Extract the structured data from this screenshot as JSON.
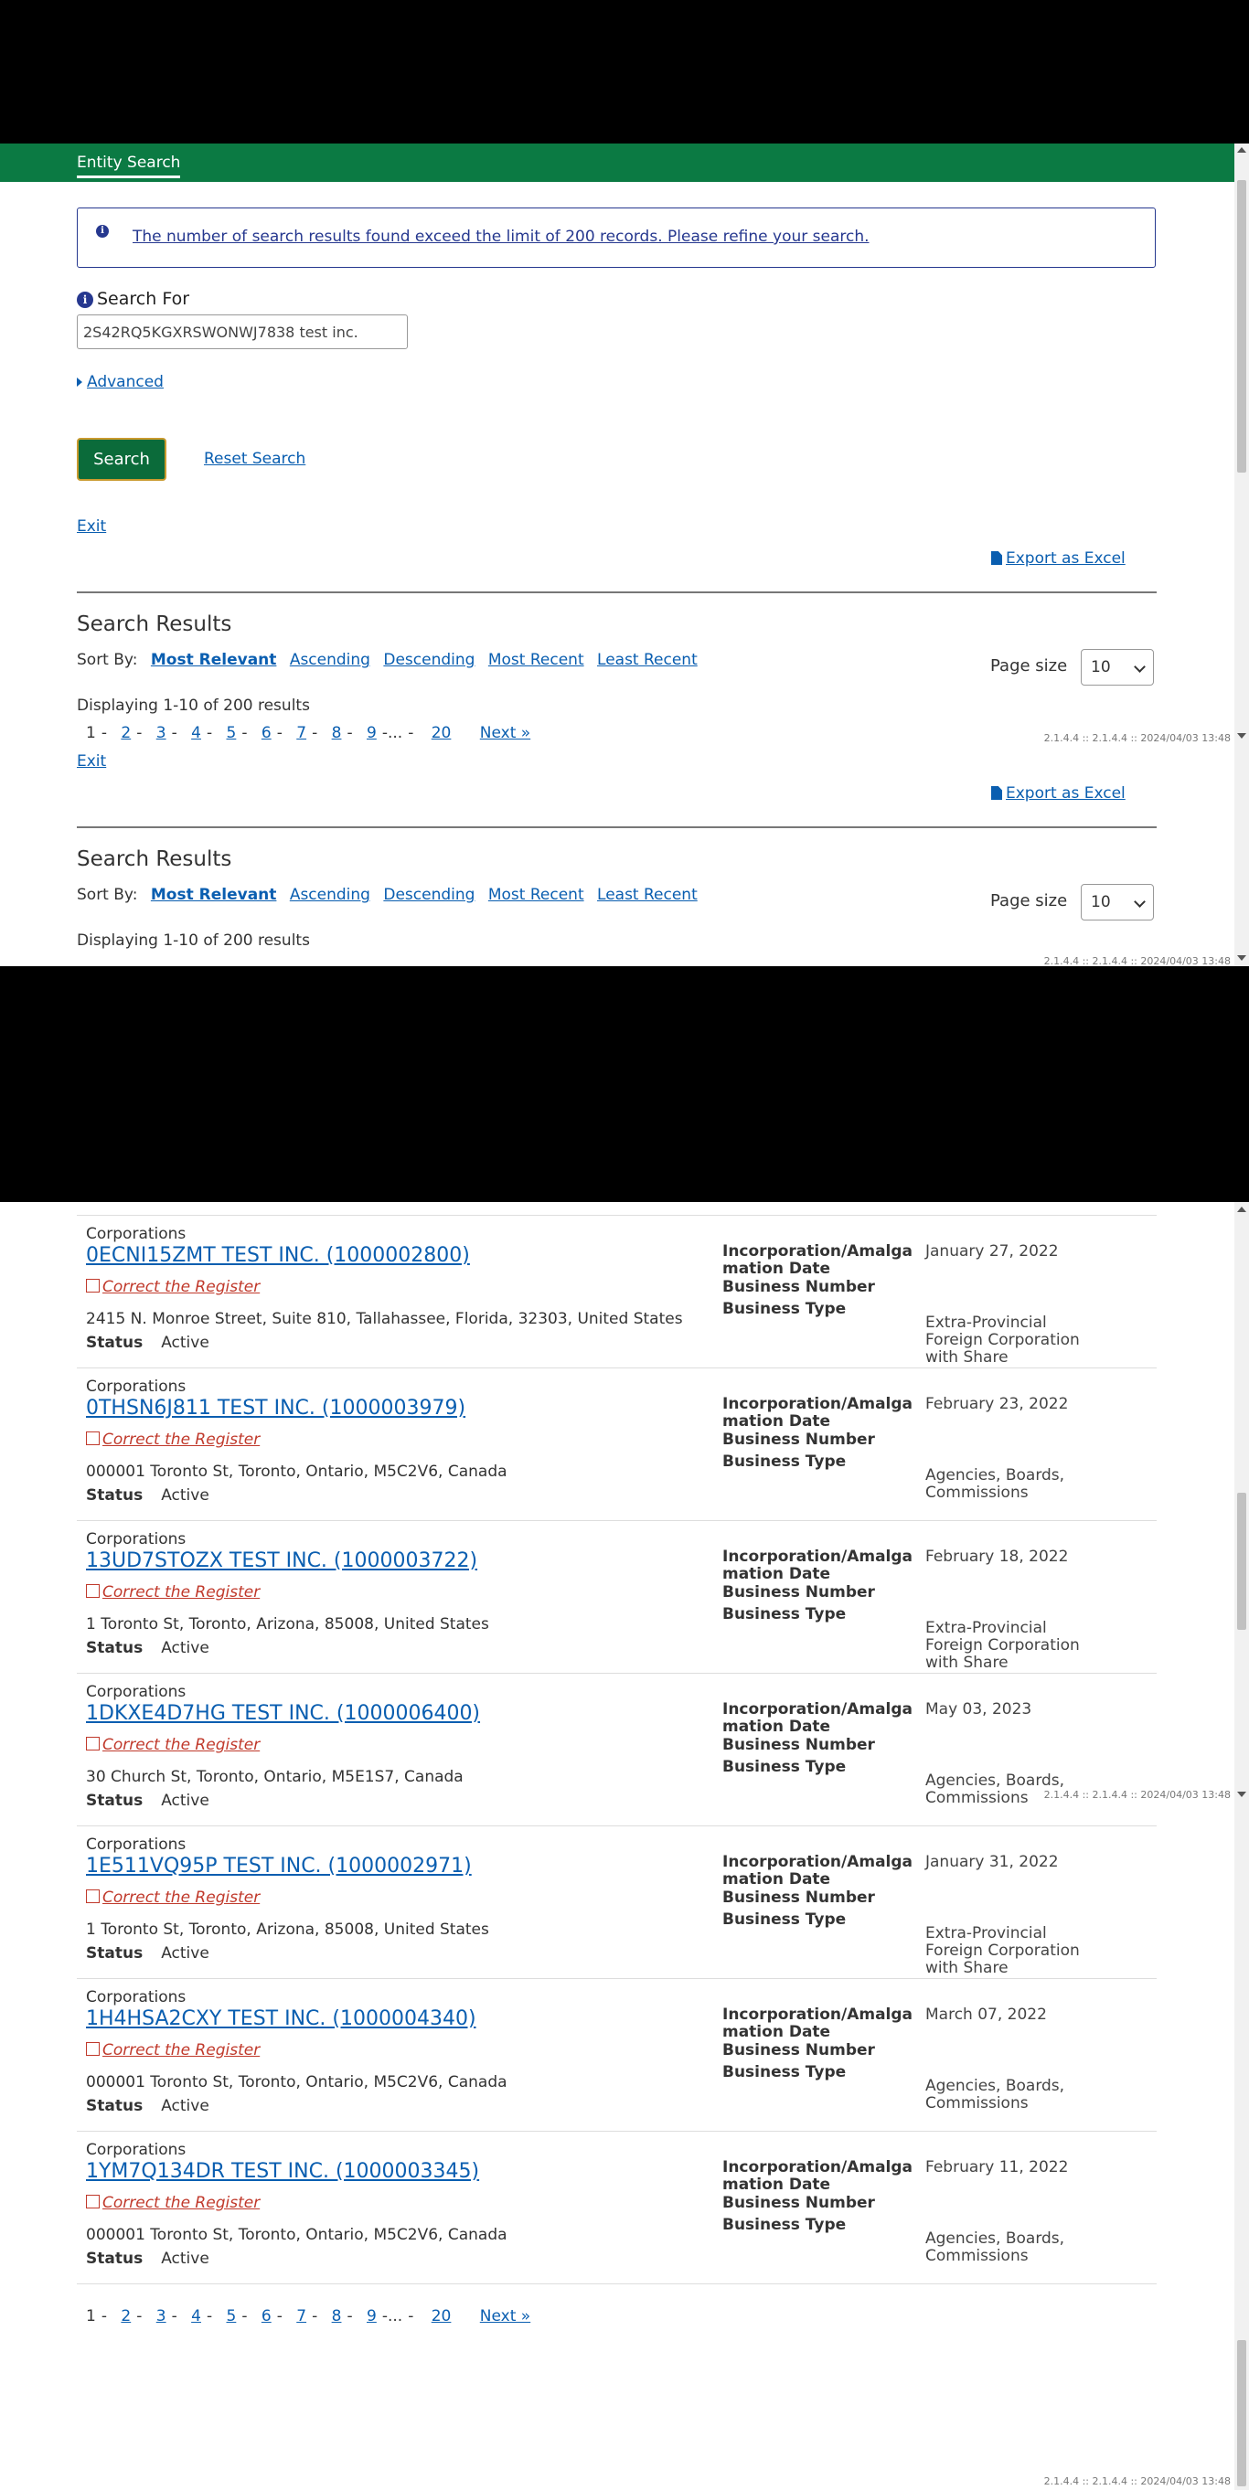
{
  "header": {
    "title": "Entity Search"
  },
  "alert": {
    "message": "The number of search results found exceed the limit of 200 records. Please refine your search."
  },
  "search": {
    "label": "Search For",
    "value": "2S42RQ5KGXRSWONWJ7838 test inc.",
    "advanced_label": "Advanced",
    "search_button": "Search",
    "reset_label": "Reset Search",
    "exit_label": "Exit",
    "export_label": "Export as Excel"
  },
  "results": {
    "title": "Search Results",
    "sort_label": "Sort By:",
    "sort_options": [
      "Most Relevant",
      "Ascending",
      "Descending",
      "Most Recent",
      "Least Recent"
    ],
    "page_size_label": "Page size",
    "page_size_value": "10",
    "displaying": "Displaying 1-10 of 200 results",
    "pages": [
      "1",
      "2",
      "3",
      "4",
      "5",
      "6",
      "7",
      "8",
      "9",
      "20"
    ],
    "ellipsis": "...",
    "next_label": "Next »",
    "version": "2.1.4.4 :: 2.1.4.4 :: 2024/04/03 13:48"
  },
  "labels": {
    "inc_date": "Incorporation/Amalga mation Date",
    "business_number": "Business Number",
    "business_type": "Business Type",
    "status": "Status",
    "correct": "Correct the Register"
  },
  "entities": [
    {
      "category": "Corporations",
      "name": "0ECNI15ZMT TEST INC. (1000002800)",
      "address": "2415 N. Monroe Street, Suite 810, Tallahassee, Florida, 32303, United States",
      "status": "Active",
      "date": "January 27, 2022",
      "type": "Extra-Provincial Foreign Corporation with Share"
    },
    {
      "category": "Corporations",
      "name": "0THSN6J811 TEST INC. (1000003979)",
      "address": "000001 Toronto St, Toronto, Ontario, M5C2V6, Canada",
      "status": "Active",
      "date": "February 23, 2022",
      "type": "Agencies, Boards, Commissions"
    },
    {
      "category": "Corporations",
      "name": "13UD7STOZX TEST INC. (1000003722)",
      "address": "1 Toronto St, Toronto, Arizona, 85008, United States",
      "status": "Active",
      "date": "February 18, 2022",
      "type": "Extra-Provincial Foreign Corporation with Share"
    },
    {
      "category": "Corporations",
      "name": "1DKXE4D7HG TEST INC. (1000006400)",
      "address": "30 Church St, Toronto, Ontario, M5E1S7, Canada",
      "status": "Active",
      "date": "May 03, 2023",
      "type": "Agencies, Boards, Commissions"
    },
    {
      "category": "Corporations",
      "name": "1E511VQ95P TEST INC. (1000002971)",
      "address": "1 Toronto St, Toronto, Arizona, 85008, United States",
      "status": "Active",
      "date": "January 31, 2022",
      "type": "Extra-Provincial Foreign Corporation with Share"
    },
    {
      "category": "Corporations",
      "name": "1H4HSA2CXY TEST INC. (1000004340)",
      "address": "000001 Toronto St, Toronto, Ontario, M5C2V6, Canada",
      "status": "Active",
      "date": "March 07, 2022",
      "type": "Agencies, Boards, Commissions"
    },
    {
      "category": "Corporations",
      "name": "1YM7Q134DR TEST INC. (1000003345)",
      "address": "000001 Toronto St, Toronto, Ontario, M5C2V6, Canada",
      "status": "Active",
      "date": "February 11, 2022",
      "type": "Agencies, Boards, Commissions"
    }
  ]
}
